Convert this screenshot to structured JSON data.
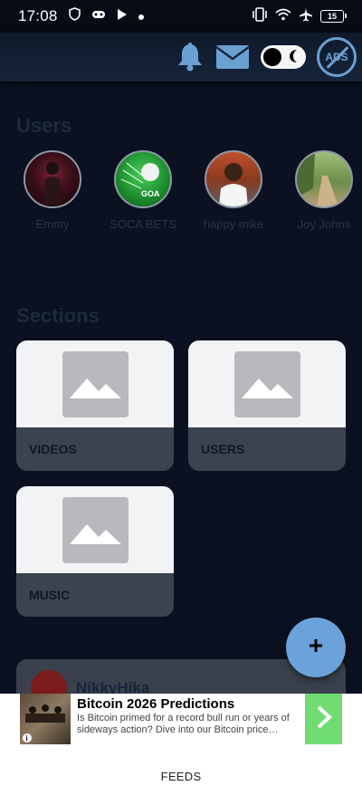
{
  "status_bar": {
    "time": "17:08",
    "battery": "15"
  },
  "header": {
    "ads_label": "ADS"
  },
  "users_section": {
    "title": "Users",
    "users": [
      {
        "name": "Emmy"
      },
      {
        "name": "SOCA BETS"
      },
      {
        "name": "happy mike"
      },
      {
        "name": "Joy Johns"
      }
    ]
  },
  "sections": {
    "title": "Sections",
    "cards": [
      {
        "label": "VIDEOS"
      },
      {
        "label": "USERS"
      },
      {
        "label": "MUSIC"
      }
    ]
  },
  "post": {
    "author": "NikkyHika"
  },
  "ad": {
    "title": "Bitcoin 2026 Predictions",
    "description": "Is Bitcoin primed for a record bull run or years of sideways action? Dive into our Bitcoin price…"
  },
  "bottom_nav": {
    "feeds_label": "FEEDS"
  },
  "colors": {
    "fab": "#6ba2d9",
    "accent": "#6aa0d2",
    "background": "#0b1120"
  }
}
